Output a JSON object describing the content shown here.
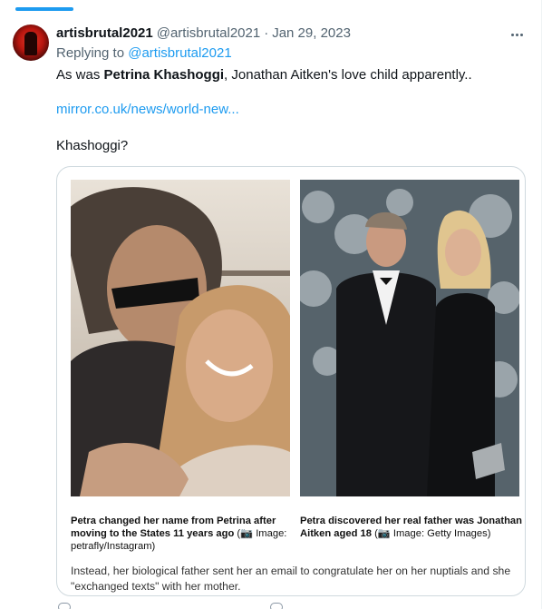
{
  "tweet": {
    "display_name": "artisbrutal2021",
    "handle": "@artisbrutal2021",
    "separator": "·",
    "date": "Jan 29, 2023",
    "replying_prefix": "Replying to",
    "replying_to": "@artisbrutal2021",
    "text_before": "As was ",
    "text_bold": "Petrina Khashoggi",
    "text_after": ", Jonathan Aitken's love child apparently..",
    "link": "mirror.co.uk/news/world-new...",
    "text_second": "Khashoggi?"
  },
  "media": {
    "left": {
      "caption_bold": "Petra changed her name from Petrina after moving to the States 11 years ago",
      "caption_open": " (",
      "caption_camera": "📷",
      "caption_credit": " Image: petrafly/Instagram)"
    },
    "right": {
      "caption_bold": "Petra discovered her real father was Jonathan Aitken aged 18",
      "caption_open": " (",
      "caption_camera": "📷",
      "caption_credit": " Image: Getty Images)"
    },
    "article_text": "Instead, her biological father sent her an email to congratulate her on her nuptials and she \"exchanged texts\" with her mother."
  },
  "colors": {
    "accent": "#1d9bf0",
    "secondary_text": "#536471",
    "border": "#cfd9de"
  },
  "icons": [
    "more-icon",
    "camera-icon"
  ]
}
